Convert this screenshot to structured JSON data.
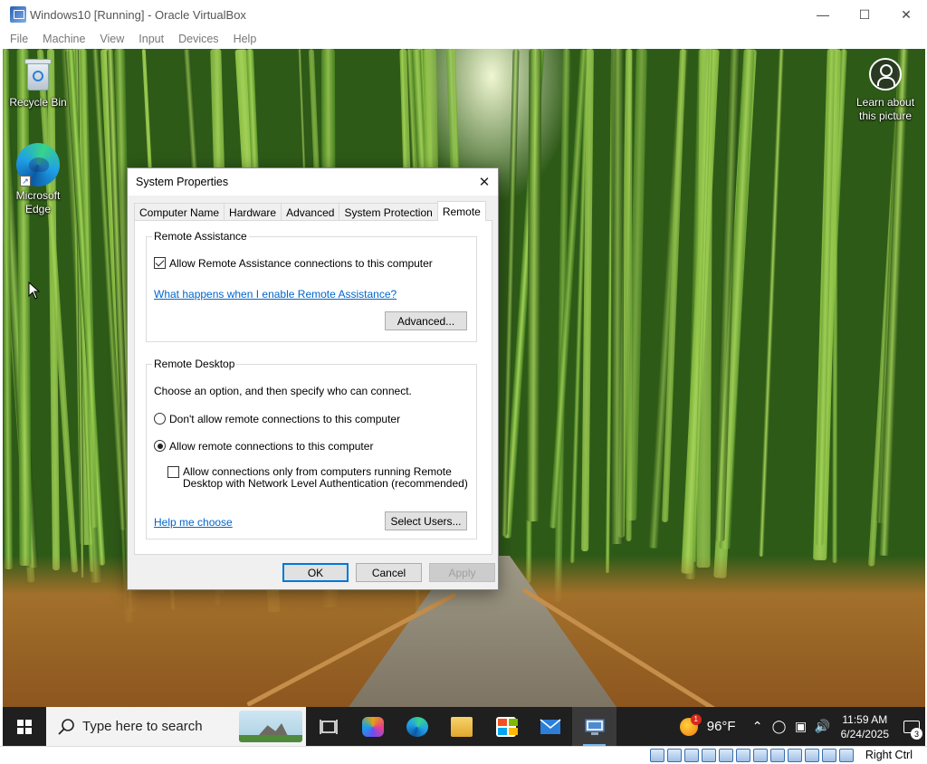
{
  "vbox": {
    "title": "Windows10 [Running] - Oracle VirtualBox",
    "menu": [
      "File",
      "Machine",
      "View",
      "Input",
      "Devices",
      "Help"
    ],
    "host_key": "Right Ctrl"
  },
  "desktop": {
    "icons": [
      {
        "label": "Recycle Bin",
        "icon": "recycle-bin-icon"
      },
      {
        "label": "Microsoft Edge",
        "icon": "edge-icon"
      }
    ],
    "learn_label": "Learn about this picture"
  },
  "dialog": {
    "title": "System Properties",
    "tabs": [
      "Computer Name",
      "Hardware",
      "Advanced",
      "System Protection",
      "Remote"
    ],
    "active_tab": "Remote",
    "remote_assistance": {
      "group_label": "Remote Assistance",
      "allow_label": "Allow Remote Assistance connections to this computer",
      "allow_checked": true,
      "help_link": "What happens when I enable Remote Assistance?",
      "advanced_button": "Advanced..."
    },
    "remote_desktop": {
      "group_label": "Remote Desktop",
      "instruction": "Choose an option, and then specify who can connect.",
      "option_deny": "Don't allow remote connections to this computer",
      "option_allow": "Allow remote connections to this computer",
      "selected": "allow",
      "nla_line1": "Allow connections only from computers running Remote",
      "nla_line2": "Desktop with Network Level Authentication (recommended)",
      "nla_checked": false,
      "help_link": "Help me choose",
      "select_users_button": "Select Users..."
    },
    "ok_button": "OK",
    "cancel_button": "Cancel",
    "apply_button": "Apply"
  },
  "taskbar": {
    "search_placeholder": "Type here to search",
    "apps": [
      "task-view-icon",
      "copilot-icon",
      "edge-icon",
      "file-explorer-icon",
      "microsoft-store-icon",
      "mail-icon",
      "system-properties-icon"
    ],
    "weather_temp": "96°F",
    "weather_badge": "1",
    "time": "11:59 AM",
    "date": "6/24/2025",
    "notification_count": "3"
  }
}
